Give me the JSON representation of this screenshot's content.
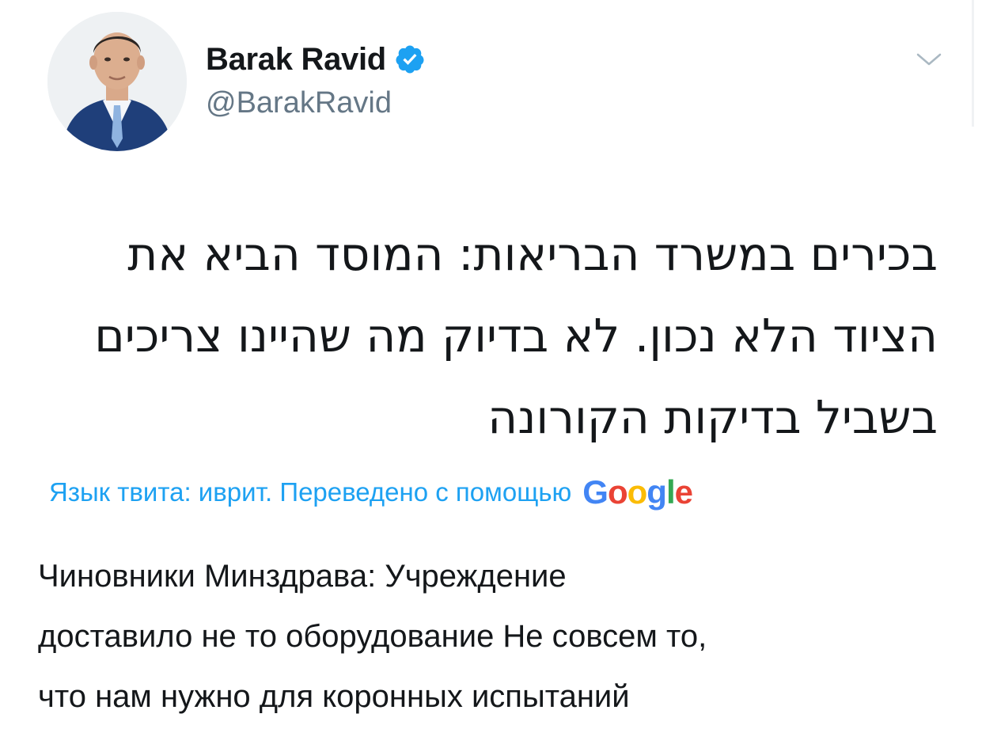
{
  "author": {
    "display_name": "Barak Ravid",
    "handle": "@BarakRavid",
    "verified": true,
    "avatar_icon": "avatar-photo"
  },
  "tweet": {
    "lines": [
      "בכירים במשרד הבריאות: המוסד הביא את",
      "הציוד הלא נכון. לא בדיוק מה שהיינו צריכים",
      "בשביל בדיקות הקורונה"
    ]
  },
  "translation": {
    "label": "Язык твита: иврит. Переведено с помощью",
    "provider_letters": [
      "G",
      "o",
      "o",
      "g",
      "l",
      "e"
    ],
    "lines": [
      "Чиновники Минздрава: Учреждение",
      "доставило не то оборудование Не совсем то,",
      "что нам нужно для коронных испытаний"
    ]
  },
  "colors": {
    "accent": "#1da1f2",
    "text": "#14171a",
    "secondary": "#657786"
  },
  "icons": {
    "verified": "verified-badge-icon",
    "menu": "chevron-down-icon"
  }
}
